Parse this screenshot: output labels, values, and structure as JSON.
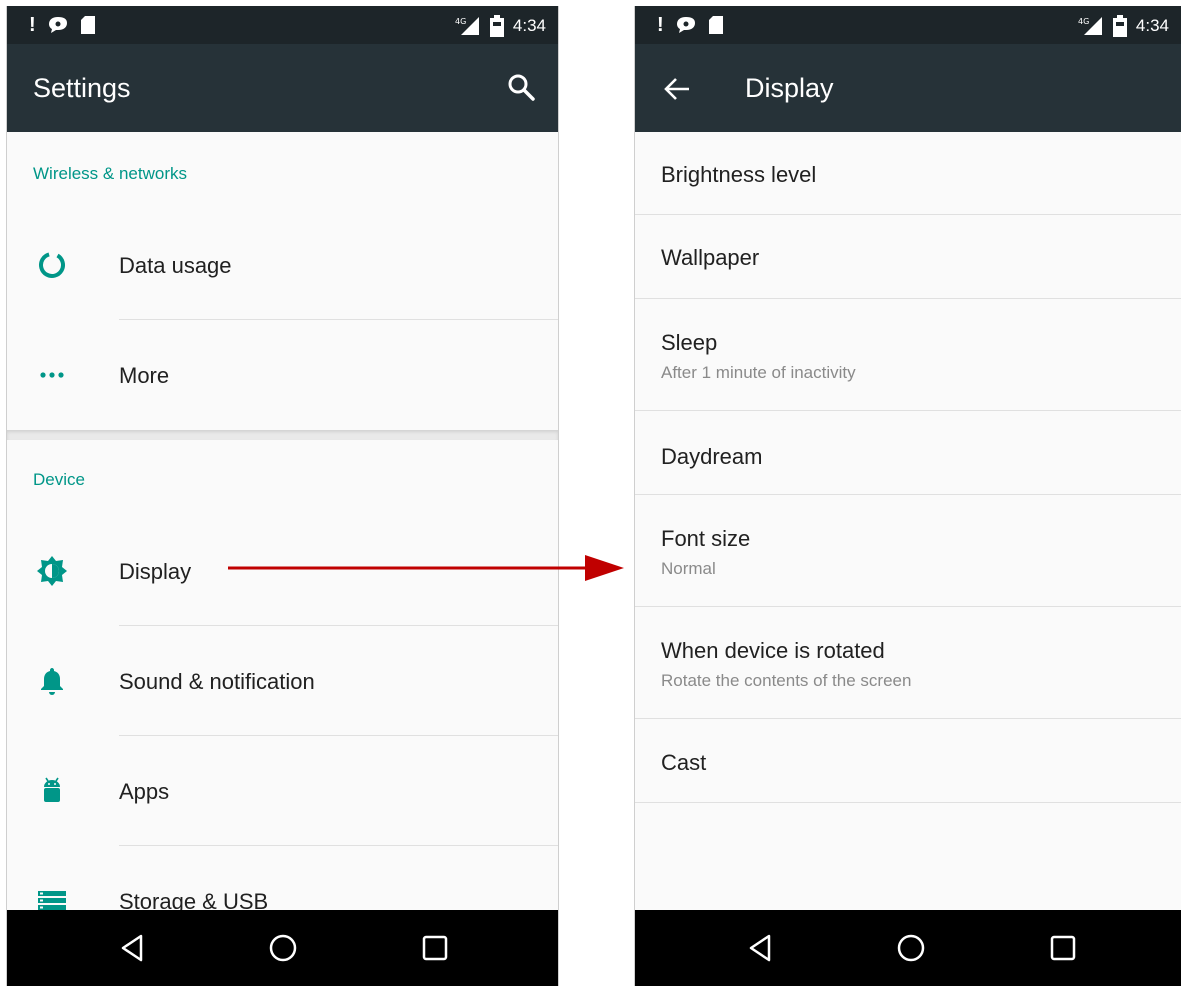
{
  "colors": {
    "appbar": "#263238",
    "statusbar": "#1d2529",
    "accent": "#009688",
    "arrow": "#c00000"
  },
  "status_bar": {
    "time": "4:34",
    "network": "4G",
    "icons": [
      "exclamation-icon",
      "message-icon",
      "sd-card-icon",
      "signal-icon",
      "battery-icon"
    ]
  },
  "left": {
    "title": "Settings",
    "sections": [
      {
        "header": "Wireless & networks",
        "items": [
          {
            "label": "Data usage",
            "icon": "data-usage-icon"
          },
          {
            "label": "More",
            "icon": "more-dots-icon"
          }
        ]
      },
      {
        "header": "Device",
        "items": [
          {
            "label": "Display",
            "icon": "brightness-icon"
          },
          {
            "label": "Sound & notification",
            "icon": "bell-icon"
          },
          {
            "label": "Apps",
            "icon": "android-icon"
          },
          {
            "label": "Storage & USB",
            "icon": "storage-icon"
          }
        ]
      }
    ]
  },
  "right": {
    "title": "Display",
    "items": [
      {
        "label": "Brightness level",
        "sub": ""
      },
      {
        "label": "Wallpaper",
        "sub": ""
      },
      {
        "label": "Sleep",
        "sub": "After 1 minute of inactivity"
      },
      {
        "label": "Daydream",
        "sub": ""
      },
      {
        "label": "Font size",
        "sub": "Normal"
      },
      {
        "label": "When device is rotated",
        "sub": "Rotate the contents of the screen"
      },
      {
        "label": "Cast",
        "sub": ""
      }
    ]
  },
  "nav": {
    "buttons": [
      "back-nav-icon",
      "home-nav-icon",
      "recents-nav-icon"
    ]
  }
}
